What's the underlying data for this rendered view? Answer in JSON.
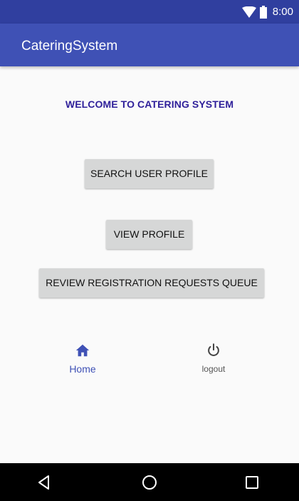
{
  "status_bar": {
    "time": "8:00",
    "icons": [
      "wifi-icon",
      "battery-icon"
    ],
    "color": "#303f9f"
  },
  "app_bar": {
    "title": "CateringSystem",
    "color": "#3f51b5"
  },
  "main": {
    "welcome_text": "WELCOME TO CATERING SYSTEM",
    "buttons": [
      {
        "label": "SEARCH USER PROFILE"
      },
      {
        "label": "VIEW PROFILE"
      },
      {
        "label": "REVIEW REGISTRATION REQUESTS QUEUE"
      }
    ]
  },
  "bottom_nav": {
    "items": [
      {
        "label": "Home",
        "icon": "home-icon",
        "active": true
      },
      {
        "label": "logout",
        "icon": "power-icon",
        "active": false
      }
    ]
  },
  "system_nav": {
    "icons": [
      "back-icon",
      "home-circle-icon",
      "recents-icon"
    ]
  }
}
